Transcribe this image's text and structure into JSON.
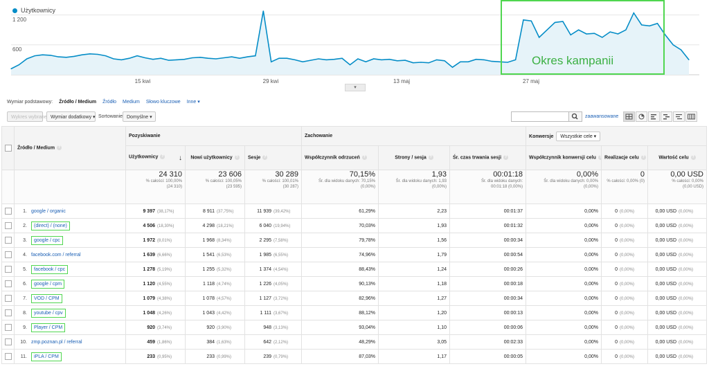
{
  "chart": {
    "legend": "Użytkownicy",
    "y_ticks": [
      "1 200",
      "600"
    ],
    "x_ticks": [
      "15 kwi",
      "29 kwi",
      "13 maj",
      "27 maj"
    ],
    "campaign_label": "Okres kampanii",
    "series_color": "#058dc7",
    "campaign_color": "#4fd64f"
  },
  "chart_data": {
    "type": "line",
    "series": [
      {
        "name": "Użytkownicy",
        "values": [
          120,
          200,
          320,
          380,
          400,
          390,
          360,
          350,
          370,
          400,
          420,
          410,
          380,
          320,
          300,
          330,
          380,
          340,
          310,
          330,
          290,
          300,
          310,
          340,
          350,
          330,
          320,
          340,
          360,
          330,
          360,
          380,
          1280,
          260,
          330,
          330,
          300,
          260,
          290,
          320,
          300,
          310,
          330,
          200,
          320,
          260,
          320,
          300,
          310,
          280,
          290,
          240,
          250,
          240,
          300,
          280,
          150,
          260,
          260,
          310,
          300,
          270,
          260,
          250,
          300,
          1100,
          1080,
          750,
          900,
          1050,
          1070,
          800,
          900,
          820,
          830,
          750,
          860,
          820,
          900,
          1240,
          1000,
          980,
          1030,
          800,
          600,
          500,
          300
        ]
      }
    ],
    "y_ticks": [
      "1 200",
      "600"
    ],
    "x_ticks": [
      "15 kwi",
      "29 kwi",
      "13 maj",
      "27 maj"
    ],
    "ylim": [
      0,
      1500
    ]
  },
  "dimensions": {
    "label": "Wymiar podstawowy:",
    "options": [
      "Źródło / Medium",
      "Źródło",
      "Medium",
      "Słowo kluczowe",
      "Inne"
    ]
  },
  "toolbar": {
    "plot_rows": "Wykres wybrane",
    "secondary_dim": "Wymiar dodatkowy",
    "sort_label": "Sortowanie:",
    "sort_value": "Domyślne",
    "advanced": "zaawansowane"
  },
  "table": {
    "groups": {
      "acquisition": "Pozyskiwanie",
      "behavior": "Zachowanie",
      "conversions": "Konwersje",
      "goals_select": "Wszystkie cele"
    },
    "columns": [
      "Źródło / Medium",
      "Użytkownicy",
      "Nowi użytkownicy",
      "Sesje",
      "Współczynnik odrzuceń",
      "Strony / sesja",
      "Śr. czas trwania sesji",
      "Współczynnik konwersji celu",
      "Realizacje celu",
      "Wartość celu"
    ],
    "totals": {
      "users": "24 310",
      "users_sub1": "% całości: 100,00%",
      "users_sub2": "(24 310)",
      "new_users": "23 606",
      "new_users_sub1": "% całości: 100,05%",
      "new_users_sub2": "(23 595)",
      "sessions": "30 289",
      "sessions_sub1": "% całości: 100,01%",
      "sessions_sub2": "(30 287)",
      "bounce": "70,15%",
      "bounce_sub1": "Śr. dla widoku danych: 70,15%",
      "bounce_sub2": "(0,00%)",
      "pages": "1,93",
      "pages_sub1": "Śr. dla widoku danych: 1,93",
      "pages_sub2": "(0,00%)",
      "duration": "00:01:18",
      "duration_sub1": "Śr. dla widoku danych:",
      "duration_sub2": "00:01:18 (0,00%)",
      "conv_rate": "0,00%",
      "conv_rate_sub1": "Śr. dla widoku danych: 0,00%",
      "conv_rate_sub2": "(0,00%)",
      "completions": "0",
      "completions_sub1": "% całości: 0,00% (0)",
      "value": "0,00 USD",
      "value_sub1": "% całości: 0,00%",
      "value_sub2": "(0,00 USD)"
    },
    "rows": [
      {
        "idx": "1.",
        "name": "google / organic",
        "boxed": false,
        "users": "9 397",
        "users_pct": "(38,17%)",
        "new_users": "8 911",
        "new_pct": "(37,75%)",
        "sessions": "11 939",
        "sess_pct": "(39,42%)",
        "bounce": "61,29%",
        "pages": "2,23",
        "duration": "00:01:37",
        "conv": "0,00%",
        "comp": "0",
        "comp_pct": "(0,00%)",
        "value": "0,00 USD",
        "value_pct": "(0,00%)"
      },
      {
        "idx": "2.",
        "name": "(direct) / (none)",
        "boxed": true,
        "users": "4 506",
        "users_pct": "(18,30%)",
        "new_users": "4 298",
        "new_pct": "(18,21%)",
        "sessions": "6 040",
        "sess_pct": "(19,94%)",
        "bounce": "70,03%",
        "pages": "1,93",
        "duration": "00:01:32",
        "conv": "0,00%",
        "comp": "0",
        "comp_pct": "(0,00%)",
        "value": "0,00 USD",
        "value_pct": "(0,00%)"
      },
      {
        "idx": "3.",
        "name": "google / cpc",
        "boxed": true,
        "users": "1 972",
        "users_pct": "(8,01%)",
        "new_users": "1 968",
        "new_pct": "(8,34%)",
        "sessions": "2 295",
        "sess_pct": "(7,58%)",
        "bounce": "79,78%",
        "pages": "1,56",
        "duration": "00:00:34",
        "conv": "0,00%",
        "comp": "0",
        "comp_pct": "(0,00%)",
        "value": "0,00 USD",
        "value_pct": "(0,00%)"
      },
      {
        "idx": "4.",
        "name": "facebook.com / referral",
        "boxed": false,
        "users": "1 639",
        "users_pct": "(6,66%)",
        "new_users": "1 541",
        "new_pct": "(6,53%)",
        "sessions": "1 985",
        "sess_pct": "(6,55%)",
        "bounce": "74,96%",
        "pages": "1,79",
        "duration": "00:00:54",
        "conv": "0,00%",
        "comp": "0",
        "comp_pct": "(0,00%)",
        "value": "0,00 USD",
        "value_pct": "(0,00%)"
      },
      {
        "idx": "5.",
        "name": "facebook / cpc",
        "boxed": true,
        "users": "1 278",
        "users_pct": "(5,19%)",
        "new_users": "1 255",
        "new_pct": "(5,32%)",
        "sessions": "1 374",
        "sess_pct": "(4,54%)",
        "bounce": "88,43%",
        "pages": "1,24",
        "duration": "00:00:26",
        "conv": "0,00%",
        "comp": "0",
        "comp_pct": "(0,00%)",
        "value": "0,00 USD",
        "value_pct": "(0,00%)"
      },
      {
        "idx": "6.",
        "name": "google / cpm",
        "boxed": true,
        "users": "1 120",
        "users_pct": "(4,55%)",
        "new_users": "1 118",
        "new_pct": "(4,74%)",
        "sessions": "1 226",
        "sess_pct": "(4,05%)",
        "bounce": "90,13%",
        "pages": "1,18",
        "duration": "00:00:18",
        "conv": "0,00%",
        "comp": "0",
        "comp_pct": "(0,00%)",
        "value": "0,00 USD",
        "value_pct": "(0,00%)"
      },
      {
        "idx": "7.",
        "name": "VOD / CPM",
        "boxed": true,
        "users": "1 079",
        "users_pct": "(4,38%)",
        "new_users": "1 078",
        "new_pct": "(4,57%)",
        "sessions": "1 127",
        "sess_pct": "(3,72%)",
        "bounce": "82,96%",
        "pages": "1,27",
        "duration": "00:00:34",
        "conv": "0,00%",
        "comp": "0",
        "comp_pct": "(0,00%)",
        "value": "0,00 USD",
        "value_pct": "(0,00%)"
      },
      {
        "idx": "8.",
        "name": "youtube / cpv",
        "boxed": true,
        "users": "1 048",
        "users_pct": "(4,26%)",
        "new_users": "1 043",
        "new_pct": "(4,42%)",
        "sessions": "1 111",
        "sess_pct": "(3,67%)",
        "bounce": "88,12%",
        "pages": "1,20",
        "duration": "00:00:13",
        "conv": "0,00%",
        "comp": "0",
        "comp_pct": "(0,00%)",
        "value": "0,00 USD",
        "value_pct": "(0,00%)"
      },
      {
        "idx": "9.",
        "name": "Player / CPM",
        "boxed": true,
        "users": "920",
        "users_pct": "(3,74%)",
        "new_users": "920",
        "new_pct": "(3,90%)",
        "sessions": "948",
        "sess_pct": "(3,13%)",
        "bounce": "93,04%",
        "pages": "1,10",
        "duration": "00:00:06",
        "conv": "0,00%",
        "comp": "0",
        "comp_pct": "(0,00%)",
        "value": "0,00 USD",
        "value_pct": "(0,00%)"
      },
      {
        "idx": "10.",
        "name": "zmp.poznan.pl / referral",
        "boxed": false,
        "users": "459",
        "users_pct": "(1,86%)",
        "new_users": "384",
        "new_pct": "(1,63%)",
        "sessions": "642",
        "sess_pct": "(2,12%)",
        "bounce": "48,29%",
        "pages": "3,05",
        "duration": "00:02:33",
        "conv": "0,00%",
        "comp": "0",
        "comp_pct": "(0,00%)",
        "value": "0,00 USD",
        "value_pct": "(0,00%)"
      },
      {
        "idx": "11.",
        "name": "iPLA / CPM",
        "boxed": true,
        "users": "233",
        "users_pct": "(0,95%)",
        "new_users": "233",
        "new_pct": "(0,99%)",
        "sessions": "239",
        "sess_pct": "(0,79%)",
        "bounce": "87,03%",
        "pages": "1,17",
        "duration": "00:00:05",
        "conv": "0,00%",
        "comp": "0",
        "comp_pct": "(0,00%)",
        "value": "0,00 USD",
        "value_pct": "(0,00%)"
      }
    ]
  }
}
